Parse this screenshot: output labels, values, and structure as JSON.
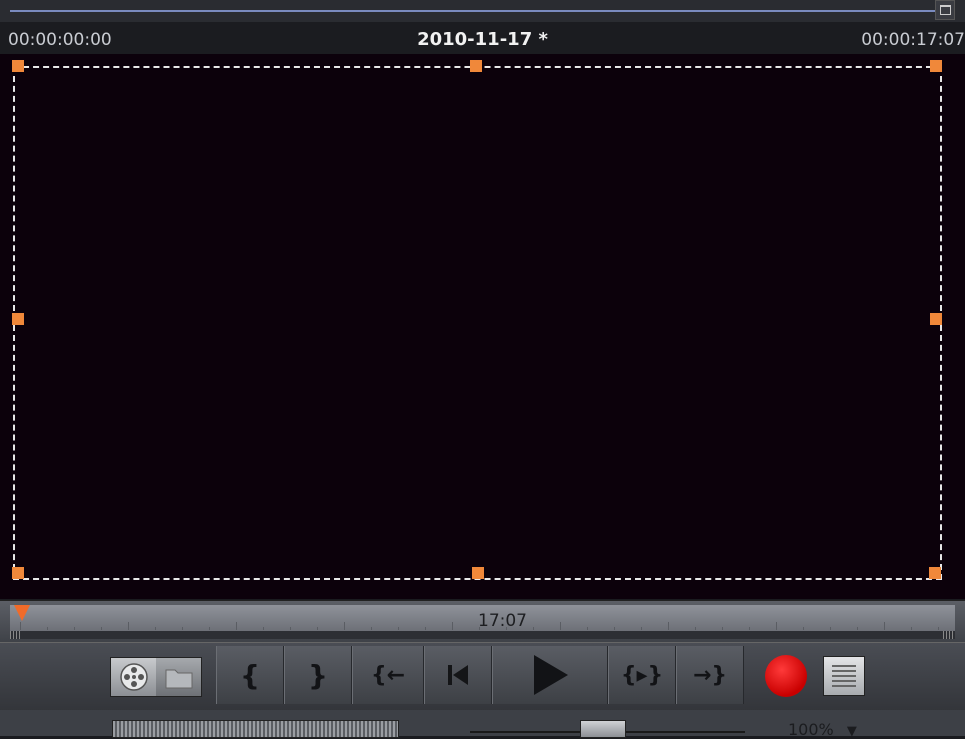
{
  "header": {
    "start_timecode": "00:00:00:00",
    "title": "2010-11-17 *",
    "end_timecode": "00:00:17:07"
  },
  "scrubber": {
    "current_time": "17:07"
  },
  "transport": {
    "buttons": [
      {
        "name": "mark-in",
        "icon": "brace-open-icon",
        "glyph": "{"
      },
      {
        "name": "mark-out",
        "icon": "brace-close-icon",
        "glyph": "}"
      },
      {
        "name": "go-to-mark-in",
        "icon": "jump-to-in-icon",
        "glyph": "{←"
      },
      {
        "name": "go-to-start",
        "icon": "skip-to-start-icon",
        "glyph": "⏮"
      },
      {
        "name": "play",
        "icon": "play-icon",
        "glyph": "▶"
      },
      {
        "name": "play-in-to-out",
        "icon": "play-range-icon",
        "glyph": "{▸}"
      },
      {
        "name": "go-to-mark-out",
        "icon": "jump-to-out-icon",
        "glyph": "→}"
      }
    ],
    "record_color": "#d40000"
  },
  "zoom": {
    "label": "100%",
    "dropdown_icon": "chevron-down-icon",
    "arrow": "▼"
  },
  "colors": {
    "preview_bg": "#0c010b",
    "handle": "#f0883a",
    "playhead": "#f06b2a"
  }
}
